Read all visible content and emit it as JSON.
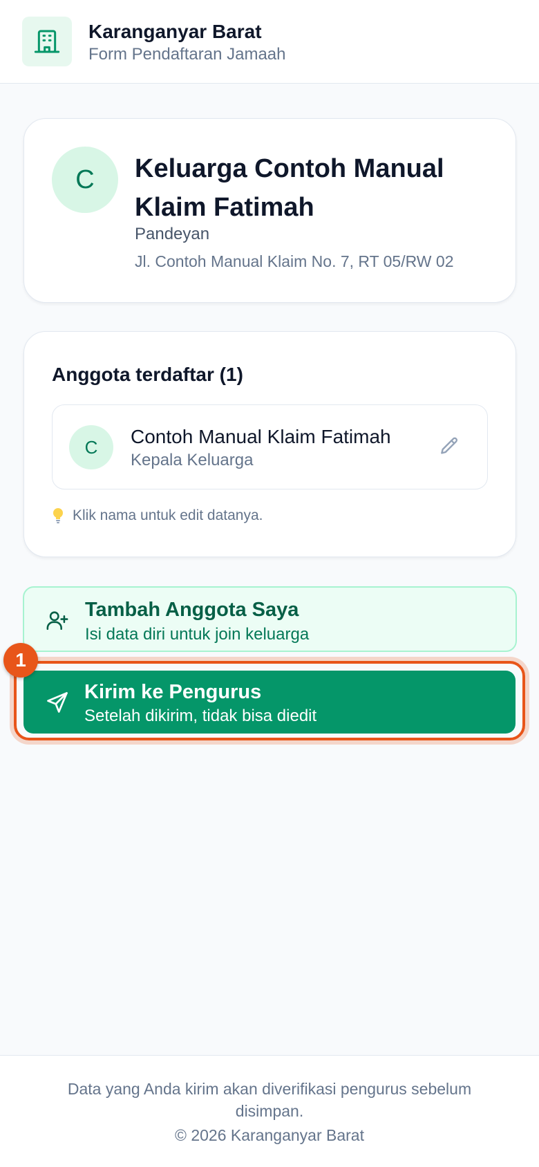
{
  "header": {
    "title": "Karanganyar Barat",
    "subtitle": "Form Pendaftaran Jamaah",
    "logo_icon": "building-icon"
  },
  "family": {
    "avatar_letter": "C",
    "name": "Keluarga Contoh Manual Klaim Fatimah",
    "area": "Pandeyan",
    "address": "Jl. Contoh Manual Klaim No. 7, RT 05/RW 02"
  },
  "members": {
    "title": "Anggota terdaftar (1)",
    "items": [
      {
        "avatar_letter": "C",
        "name": "Contoh Manual Klaim Fatimah",
        "role": "Kepala Keluarga",
        "action_icon": "pencil-icon"
      }
    ],
    "hint": "Klik nama untuk edit datanya.",
    "hint_icon": "lightbulb-icon"
  },
  "actions": {
    "add_member": {
      "label": "Tambah Anggota Saya",
      "sub": "Isi data diri untuk join keluarga",
      "icon": "user-plus-icon"
    },
    "send": {
      "label": "Kirim ke Pengurus",
      "sub": "Setelah dikirim, tidak bisa diedit",
      "icon": "send-icon"
    },
    "highlight_badge": "1"
  },
  "footer": {
    "note": "Data yang Anda kirim akan diverifikasi pengurus sebelum disimpan.",
    "copyright": "© 2026 Karanganyar Barat"
  },
  "colors": {
    "primary": "#059669",
    "primary_soft": "#ecfdf5",
    "highlight": "#e8551a"
  }
}
